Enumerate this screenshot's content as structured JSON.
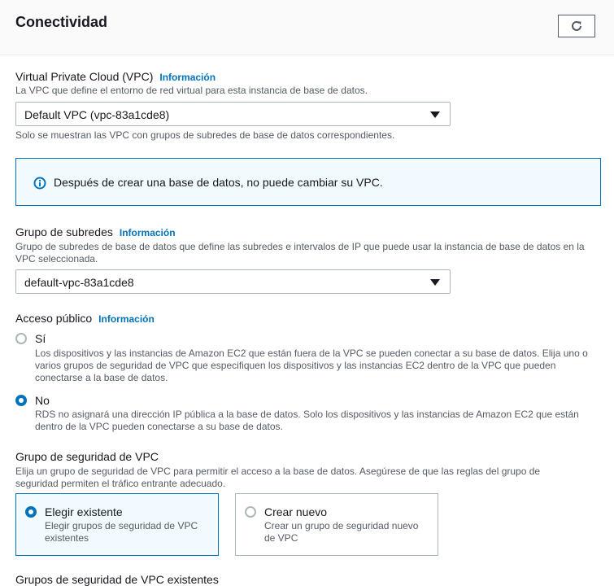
{
  "header": {
    "title": "Conectividad",
    "refresh_icon": "refresh-icon"
  },
  "vpc": {
    "label": "Virtual Private Cloud (VPC)",
    "info": "Información",
    "description": "La VPC que define el entorno de red virtual para esta instancia de base de datos.",
    "value": "Default VPC (vpc-83a1cde8)",
    "hint": "Solo se muestran las VPC con grupos de subredes de base de datos correspondientes."
  },
  "alert": {
    "text": "Después de crear una base de datos, no puede cambiar su VPC.",
    "icon": "info-icon"
  },
  "subnet": {
    "label": "Grupo de subredes",
    "info": "Información",
    "description_1": "Grupo de subredes de base de datos que define las subredes e intervalos de IP que puede usar la instancia de base de datos en la",
    "description_2": "VPC seleccionada.",
    "value": "default-vpc-83a1cde8"
  },
  "public_access": {
    "label": "Acceso público",
    "info": "Información",
    "options": [
      {
        "label": "Sí",
        "selected": false,
        "desc_1": "Los dispositivos y las instancias de Amazon EC2 que están fuera de la VPC se pueden conectar a su base de datos. Elija uno o",
        "desc_2": "varios grupos de seguridad de VPC que especifiquen los dispositivos y las instancias EC2 dentro de la VPC que pueden",
        "desc_3": "conectarse a la base de datos."
      },
      {
        "label": "No",
        "selected": true,
        "desc_1": "RDS no asignará una dirección IP pública a la base de datos. Solo los dispositivos y las instancias de Amazon EC2 que están",
        "desc_2": "dentro de la VPC pueden conectarse a su base de datos."
      }
    ]
  },
  "security_group": {
    "label": "Grupo de seguridad de VPC",
    "description_1": "Elija un grupo de seguridad de VPC para permitir el acceso a la base de datos. Asegúrese de que las reglas del grupo de",
    "description_2": "seguridad permiten el tráfico entrante adecuado.",
    "tiles": [
      {
        "title": "Elegir existente",
        "desc": "Elegir grupos de seguridad de VPC existentes",
        "selected": true
      },
      {
        "title": "Crear nuevo",
        "desc": "Crear un grupo de seguridad nuevo de VPC",
        "selected": false
      }
    ]
  },
  "existing_groups": {
    "label": "Grupos de seguridad de VPC existentes"
  },
  "colors": {
    "accent": "#0073bb",
    "info_bg": "#f1faff",
    "header_bg": "#fafafa"
  }
}
